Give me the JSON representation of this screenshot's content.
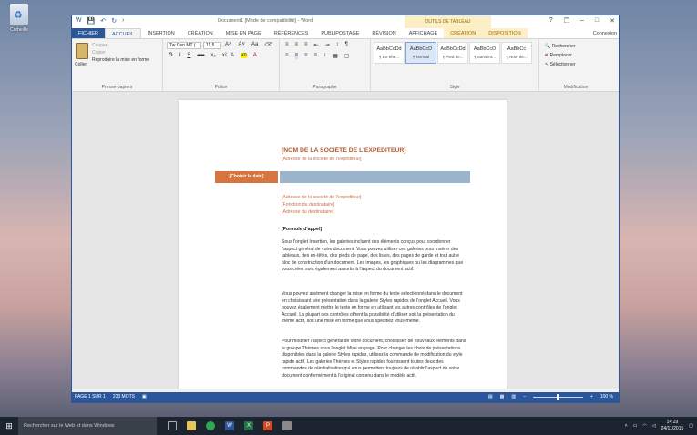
{
  "desktop": {
    "recycle_bin_label": "Corbeille"
  },
  "window": {
    "title": "Document1 [Mode de compatibilité] - Word",
    "context_group": "OUTILS DE TABLEAU",
    "qat": [
      "W",
      "💾",
      "↶",
      "↻",
      "›"
    ],
    "controls": [
      "?",
      "❐",
      "–",
      "□",
      "✕"
    ]
  },
  "tabs": {
    "file": "FICHIER",
    "items": [
      "ACCUEIL",
      "INSERTION",
      "CRÉATION",
      "MISE EN PAGE",
      "RÉFÉRENCES",
      "PUBLIPOSTAGE",
      "RÉVISION",
      "AFFICHAGE"
    ],
    "ctx_items": [
      "CRÉATION",
      "DISPOSITION"
    ],
    "signin": "Connexion"
  },
  "ribbon": {
    "clipboard": {
      "paste": "Coller",
      "cut": "Couper",
      "copy": "Copier",
      "format_painter": "Reproduire la mise en forme",
      "label": "Presse-papiers"
    },
    "font": {
      "name": "Tw Cen MT (",
      "size": "11,5",
      "label": "Police",
      "row1": [
        "A˄",
        "A˅",
        "Aa",
        "⌫"
      ],
      "row2": [
        "G",
        "I",
        "S",
        "abc",
        "x₂",
        "x²"
      ],
      "row3": [
        "A",
        "ab",
        "A"
      ]
    },
    "paragraph": {
      "label": "Paragraphe",
      "row1": [
        "≡",
        "≡",
        "≡",
        "⇤",
        "⇥",
        "↕",
        "¶"
      ],
      "row2": [
        "≡",
        "≡",
        "≡",
        "≡",
        "↕",
        "▦",
        "▢"
      ]
    },
    "styles": {
      "label": "Style",
      "items": [
        {
          "preview": "AaBbCcDd",
          "name": "¶ En-tête..."
        },
        {
          "preview": "AaBbCcD",
          "name": "¶ Normal"
        },
        {
          "preview": "AaBbCcDd",
          "name": "¶ Pied de..."
        },
        {
          "preview": "AaBbCcD",
          "name": "¶ Sans int..."
        },
        {
          "preview": "AaBbCc",
          "name": "¶ Nom de..."
        }
      ]
    },
    "modification": {
      "label": "Modification",
      "find": "Rechercher",
      "replace": "Remplacer",
      "select": "Sélectionner"
    }
  },
  "document": {
    "company": "[NOM DE LA SOCIÉTÉ DE L'EXPÉDITEUR]",
    "sender_address": "[Adresse de la société de l'expéditeur]",
    "date": "[Choisir la date]",
    "recipient": [
      "[Adresse de la société de l'expéditeur]",
      "[Fonction du destinataire]",
      "[Adresse du destinataire]"
    ],
    "salutation": "[Formule d'appel]",
    "paragraphs": [
      "Sous l'onglet Insertion, les galeries incluent des éléments conçus pour coordonner l'aspect général de votre document. Vous pouvez utiliser ces galeries pour insérer des tableaux, des en-têtes, des pieds de page, des listes, des pages de garde et tout autre bloc de construction d'un document. Les images, les graphiques ou les diagrammes que vous créez sont également assortis à l'aspect du document actif.",
      "Vous pouvez aisément changer la mise en forme du texte sélectionné dans le document en choisissant une présentation dans la galerie Styles rapides de l'onglet Accueil. Vous pouvez également mettre le texte en forme en utilisant les autres contrôles de l'onglet Accueil. La plupart des contrôles offrent la possibilité d'utiliser soit la présentation du thème actif, soit une mise en forme que vous spécifiez vous-même.",
      "Pour modifier l'aspect général de votre document, choisissez de nouveaux éléments dans le groupe Thèmes sous l'onglet Mise en page. Pour changer les choix de présentations disponibles dans la galerie Styles rapides, utilisez la commande de modification du style rapide actif. Les galeries Thèmes et Styles rapides fournissent toutes deux des commandes de réinitialisation qui vous permettent toujours de rétablir l'aspect de votre document conformément à l'original contenu dans le modèle actif."
    ]
  },
  "status": {
    "page": "PAGE 1 SUR 1",
    "words": "233 MOTS",
    "zoom": "100 %"
  },
  "taskbar": {
    "search_placeholder": "Rechercher sur le Web et dans Windows",
    "time": "14:19",
    "date": "24/11/2015"
  }
}
